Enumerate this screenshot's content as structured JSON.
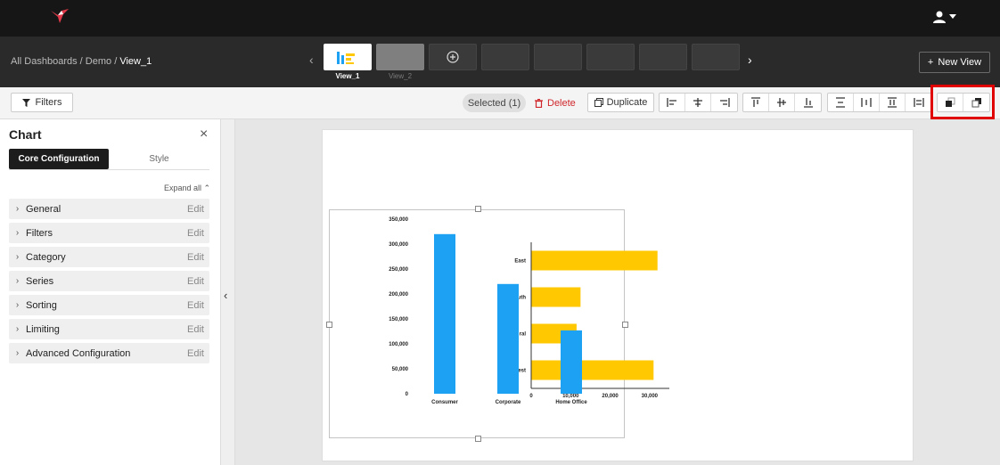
{
  "topbar": {
    "logo_icon": "hummingbird-logo-icon",
    "user_icon": "user-icon"
  },
  "breadcrumb": {
    "root": "All Dashboards",
    "sep1": "/",
    "folder": "Demo",
    "sep2": "/",
    "current": "View_1"
  },
  "views": [
    {
      "label": "View_1"
    },
    {
      "label": "View_2"
    }
  ],
  "new_view": {
    "plus": "+",
    "label": "New View"
  },
  "toolbar": {
    "filters_label": "Filters",
    "selected_label": "Selected (1)",
    "delete_label": "Delete",
    "duplicate_label": "Duplicate"
  },
  "panel": {
    "title": "Chart",
    "close": "×",
    "tabs": [
      "Core Configuration",
      "Style"
    ],
    "expand_all": "Expand all",
    "expand_all_icon": "⌃",
    "items": [
      {
        "label": "General",
        "action": "Edit"
      },
      {
        "label": "Filters",
        "action": "Edit"
      },
      {
        "label": "Category",
        "action": "Edit"
      },
      {
        "label": "Series",
        "action": "Edit"
      },
      {
        "label": "Sorting",
        "action": "Edit"
      },
      {
        "label": "Limiting",
        "action": "Edit"
      },
      {
        "label": "Advanced Configuration",
        "action": "Edit"
      }
    ]
  },
  "colors": {
    "bar_blue": "#1da1f2",
    "bar_yellow": "#ffc800",
    "highlight": "#e00000"
  },
  "chart_data": [
    {
      "type": "bar",
      "categories": [
        "Consumer",
        "Corporate",
        "Home Office"
      ],
      "values": [
        320000,
        220000,
        127000
      ],
      "ylim": [
        0,
        350000
      ],
      "yticks": [
        "0",
        "50,000",
        "100,000",
        "150,000",
        "200,000",
        "250,000",
        "300,000",
        "350,000"
      ]
    },
    {
      "type": "bar",
      "orientation": "horizontal",
      "categories": [
        "East",
        "South",
        "Central",
        "West"
      ],
      "category_labels_visible": [
        "East",
        "uth",
        "ral",
        "est"
      ],
      "values": [
        32000,
        12500,
        11500,
        31000
      ],
      "xlim": [
        0,
        35000
      ],
      "xticks": [
        "0",
        "10,000",
        "20,000",
        "30,000"
      ]
    }
  ]
}
